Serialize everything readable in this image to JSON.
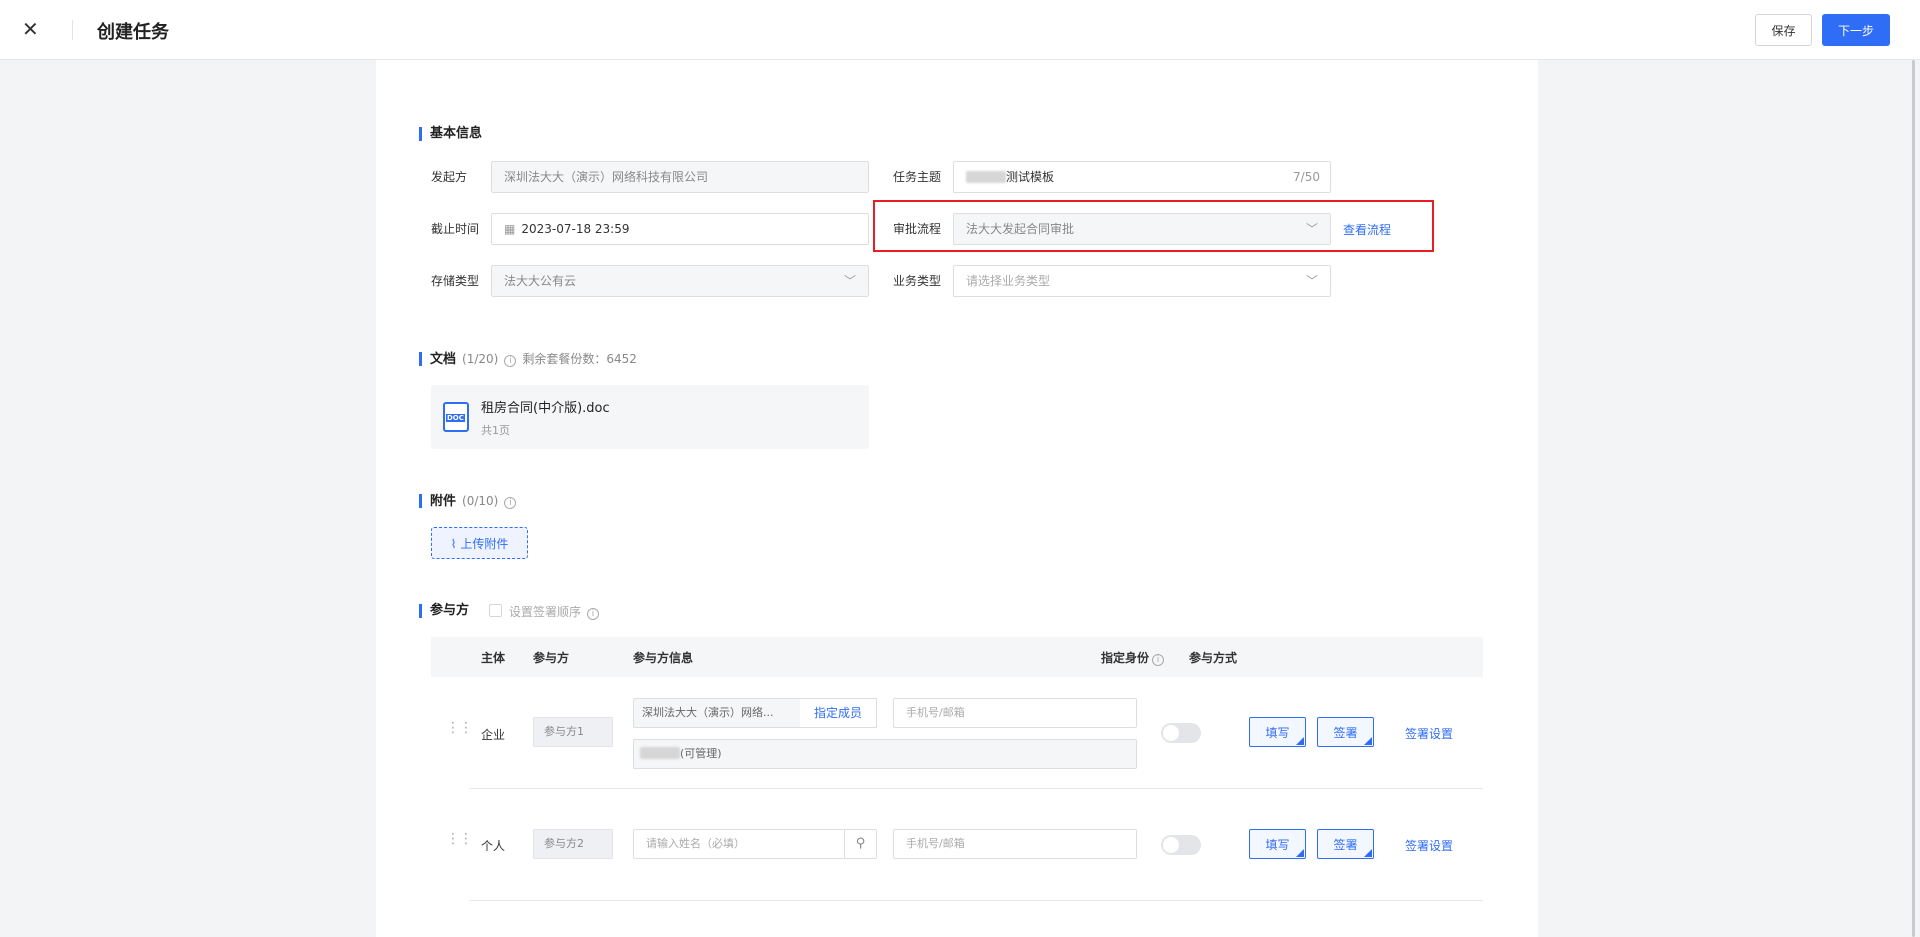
{
  "header": {
    "title": "创建任务",
    "save_label": "保存",
    "next_label": "下一步"
  },
  "basic": {
    "title": "基本信息",
    "initiator_label": "发起方",
    "initiator_value": "深圳法大大（演示）网络科技有限公司",
    "subject_label": "任务主题",
    "subject_value": "测试模板",
    "subject_count": "7/50",
    "deadline_label": "截止时间",
    "deadline_value": "2023-07-18 23:59",
    "approval_label": "审批流程",
    "approval_value": "法大大发起合同审批",
    "view_flow": "查看流程",
    "storage_label": "存储类型",
    "storage_value": "法大大公有云",
    "biztype_label": "业务类型",
    "biztype_placeholder": "请选择业务类型"
  },
  "docs": {
    "title": "文档",
    "count": "(1/20)",
    "remaining": "剩余套餐份数：6452",
    "file_name": "租房合同(中介版).doc",
    "file_pages": "共1页",
    "icon_label": "DOC"
  },
  "attachments": {
    "title": "附件",
    "count": "(0/10)",
    "upload_label": "上传附件"
  },
  "participants": {
    "title": "参与方",
    "order_label": "设置签署顺序",
    "headers": {
      "subject": "主体",
      "party": "参与方",
      "info": "参与方信息",
      "identity": "指定身份",
      "mode": "参与方式"
    },
    "rows": [
      {
        "subject": "企业",
        "party": "参与方1",
        "company": "深圳法大大（演示）网络...",
        "assign": "指定成员",
        "phone_placeholder": "手机号/邮箱",
        "member_suffix": "(可管理)",
        "fill": "填写",
        "sign": "签署",
        "settings": "签署设置"
      },
      {
        "subject": "个人",
        "party": "参与方2",
        "name_placeholder": "请输入姓名（必填）",
        "phone_placeholder": "手机号/邮箱",
        "fill": "填写",
        "sign": "签署",
        "settings": "签署设置"
      }
    ]
  }
}
